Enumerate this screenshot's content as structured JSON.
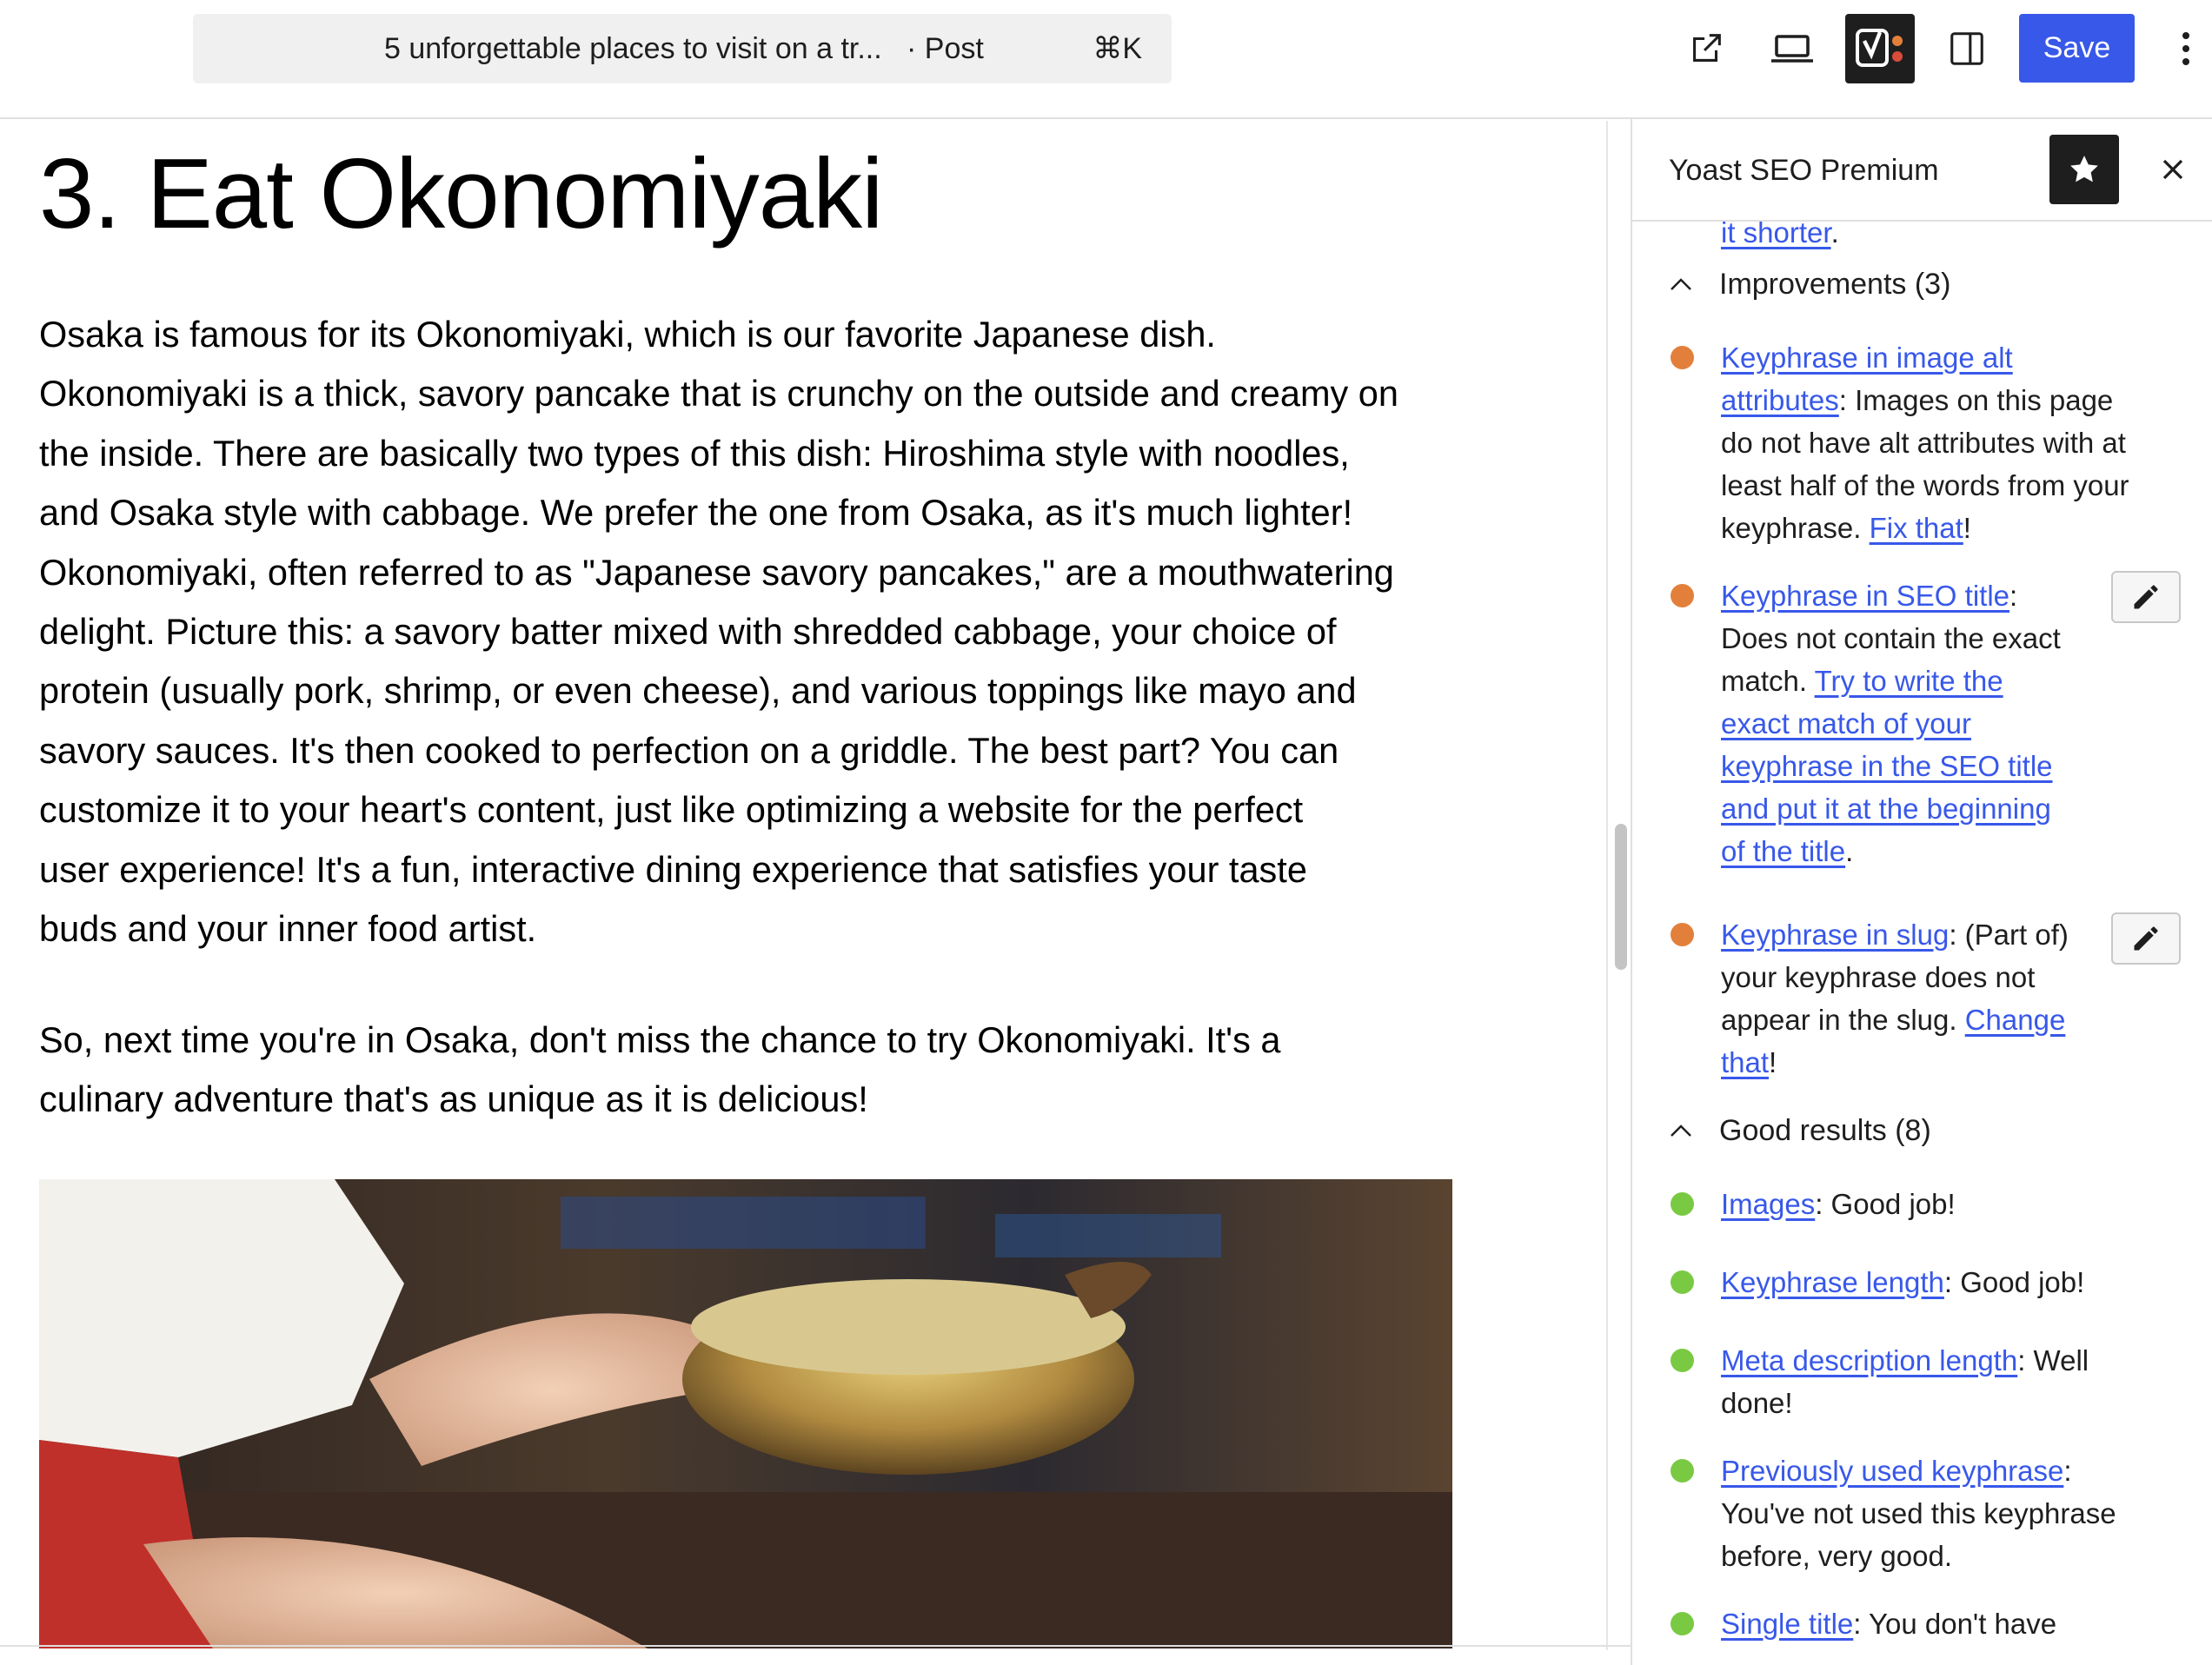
{
  "topbar": {
    "document_title": "5 unforgettable places to visit on a tr...",
    "document_type": "· Post",
    "shortcut": "⌘K",
    "icons": [
      "external-link-icon",
      "laptop-icon",
      "yoast-icon",
      "sidebar-panel-icon"
    ],
    "save_label": "Save",
    "more_icon": "vertical-ellipsis-icon",
    "colors": {
      "save": "#3858e9",
      "yoast_bg": "#1e1e1e"
    }
  },
  "editor": {
    "heading": "3. Eat Okonomiyaki",
    "paragraph1_lines": [
      "Osaka is famous for its Okonomiyaki, which is our favorite Japanese dish.",
      "Okonomiyaki is a thick, savory pancake that is crunchy on the outside and creamy on",
      "the inside. There are basically two types of this dish: Hiroshima style with noodles,",
      "and Osaka style with cabbage. We prefer the one from Osaka, as it's much lighter!",
      "Okonomiyaki, often referred to as \"Japanese savory pancakes,\" are a mouthwatering",
      "delight. Picture this: a savory batter mixed with shredded cabbage, your choice of",
      "protein (usually pork, shrimp, or even cheese), and various toppings like mayo and",
      "savory sauces. It's then cooked to perfection on a griddle. The best part? You can",
      "customize it to your heart's content, just like optimizing a website for the perfect",
      "user experience! It's a fun, interactive dining experience that satisfies your taste",
      "buds and your inner food artist."
    ],
    "paragraph2_lines": [
      "So, next time you're in Osaka, don't miss the chance to try Okonomiyaki. It's a",
      "culinary adventure that's as unique as it is delicious!"
    ]
  },
  "sidebar": {
    "title": "Yoast SEO Premium",
    "star_icon": "star-icon",
    "close_icon": "close-icon",
    "clipped_link": "it shorter",
    "clipped_tail": ".",
    "improvements": {
      "label": "Improvements (3)",
      "items": [
        {
          "link": "Keyphrase in image alt attributes",
          "link_line1": "Keyphrase in image alt",
          "link_line2": "attributes",
          "text_line2": ": Images on this page",
          "text_line3": "do not have alt attributes with at",
          "text_line4": "least half of the words from your",
          "text_line5_pre": "keyphrase. ",
          "text_line5_link": "Fix that",
          "text_line5_post": "!",
          "color": "#e2803b"
        },
        {
          "link": "Keyphrase in SEO title",
          "link_post": ":",
          "line2": "Does not contain the exact",
          "line3_pre": "match. ",
          "line3_link": "Try to write the",
          "line4_link": "exact match of your",
          "line5_link": "keyphrase in the SEO title",
          "line6_link": "and put it at the beginning",
          "line7_link": "of the title",
          "line7_post": ".",
          "edit_icon": "pencil-icon",
          "color": "#e2803b"
        },
        {
          "link": "Keyphrase in slug",
          "line1_post": ": (Part of)",
          "line2": "your keyphrase does not",
          "line3_pre": "appear in the slug. ",
          "line3_link": "Change",
          "line4_link": "that",
          "line4_post": "!",
          "edit_icon": "pencil-icon",
          "color": "#e2803b"
        }
      ]
    },
    "good_results": {
      "label": "Good results (8)",
      "items": [
        {
          "link": "Images",
          "text": ": Good job!",
          "color": "#7ac943"
        },
        {
          "link": "Keyphrase length",
          "text": ": Good job!",
          "color": "#7ac943"
        },
        {
          "link": "Meta description length",
          "text": ": Well",
          "text_line2": "done!",
          "color": "#7ac943"
        },
        {
          "link": "Previously used keyphrase",
          "text": ":",
          "text_line2": "You've not used this keyphrase",
          "text_line3": "before, very good.",
          "color": "#7ac943"
        },
        {
          "link": "Single title",
          "text": ": You don't have",
          "color": "#7ac943"
        }
      ]
    }
  }
}
